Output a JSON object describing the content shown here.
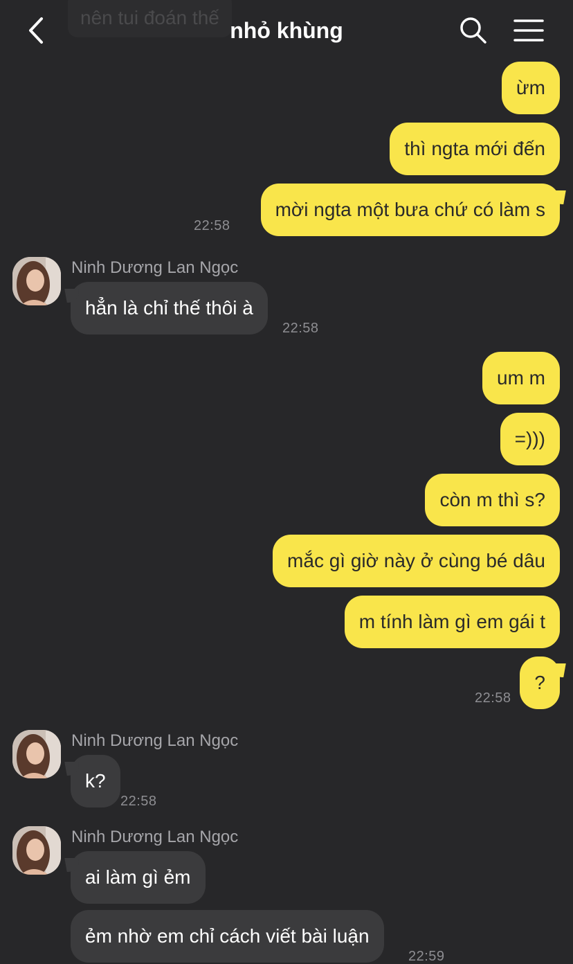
{
  "header": {
    "title": "nhỏ khùng",
    "back_icon": "chevron-left-icon",
    "search_icon": "search-icon",
    "menu_icon": "hamburger-menu-icon"
  },
  "faded_message": "nên tui đoán thế",
  "colors": {
    "background": "#272729",
    "outgoing_bubble": "#f9e54b",
    "incoming_bubble": "#3b3b3d",
    "timestamp": "#8e8e92"
  },
  "messages": {
    "m1": "ừm",
    "m2": "thì ngta mới đến",
    "m3": "mời ngta một bưa chứ có làm s",
    "m3_time": "22:58",
    "sender1": "Ninh Dương Lan Ngọc",
    "m4": "hẳn là chỉ thế thôi à",
    "m4_time": "22:58",
    "m5": "um m",
    "m6": "=)))",
    "m7": "còn m thì s?",
    "m8": "mắc gì giờ này ở cùng bé dâu",
    "m9": "m tính làm gì em gái t",
    "m10": "?",
    "m10_time": "22:58",
    "sender2": "Ninh Dương Lan Ngọc",
    "m11": "k?",
    "m11_time": "22:58",
    "sender3": "Ninh Dương Lan Ngọc",
    "m12": "ai làm gì ẻm",
    "m13": "ẻm nhờ em chỉ cách viết bài luận",
    "m13_time": "22:59"
  }
}
